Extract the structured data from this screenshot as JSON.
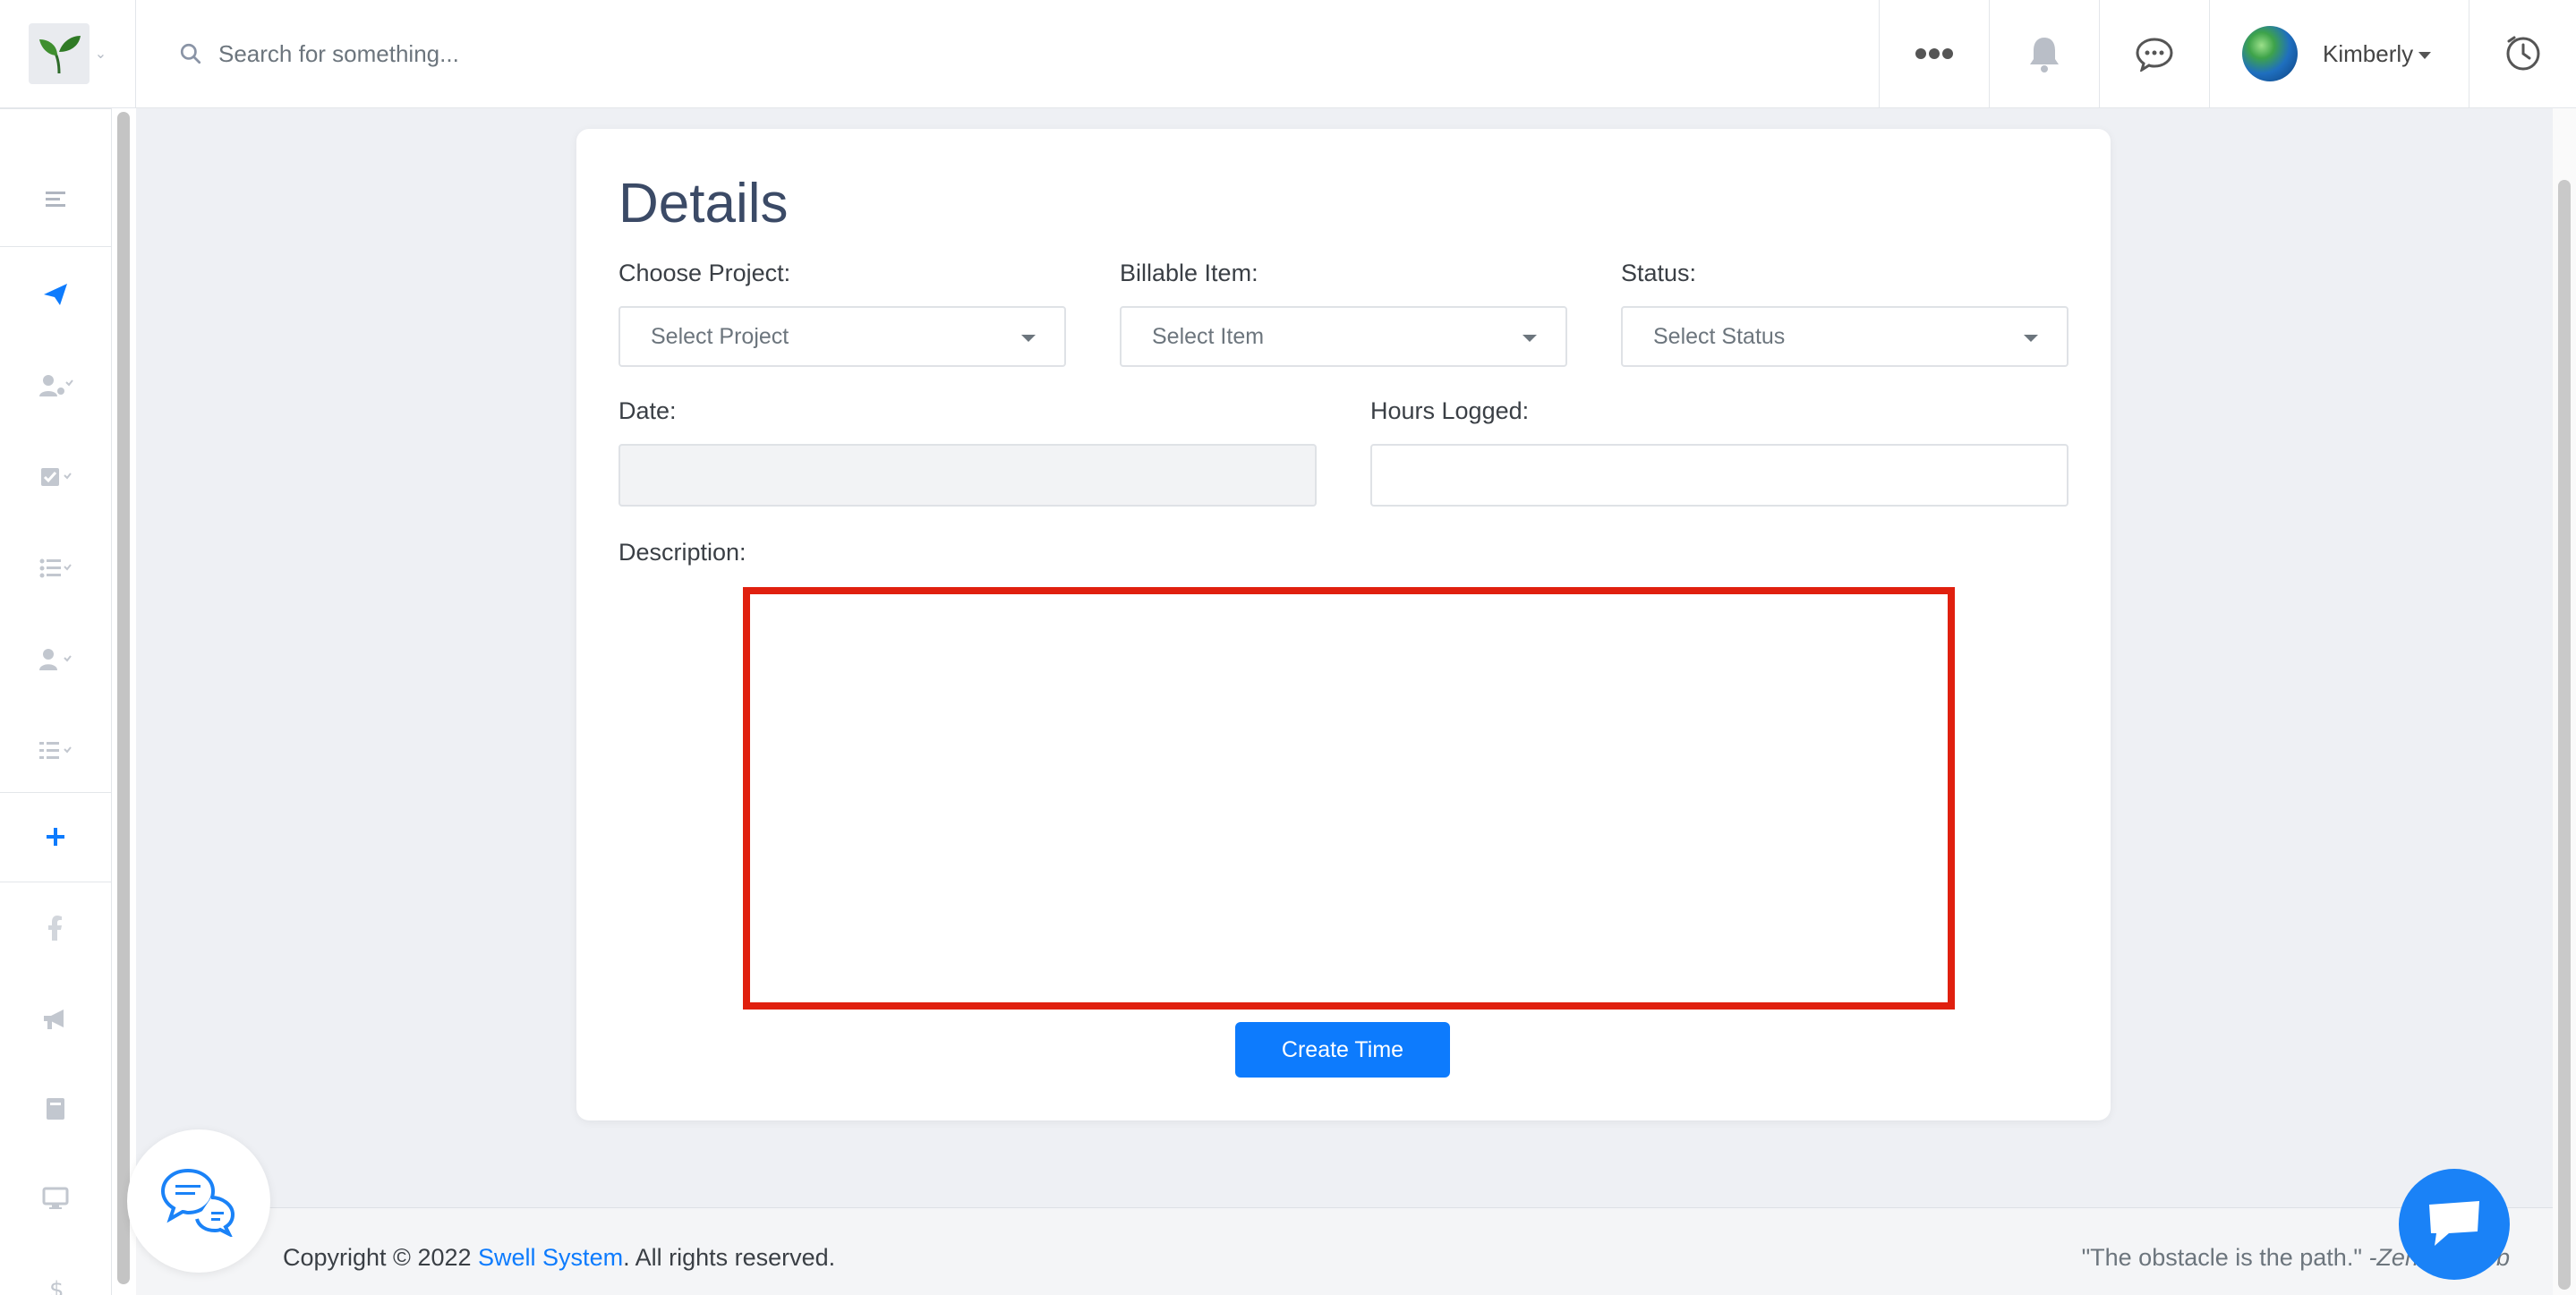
{
  "topbar": {
    "search_placeholder": "Search for something...",
    "user_name": "Kimberly"
  },
  "card": {
    "title": "Details",
    "choose_project_label": "Choose Project:",
    "project_select": "Select Project",
    "billable_item_label": "Billable Item:",
    "item_select": "Select Item",
    "status_label": "Status:",
    "status_select": "Select Status",
    "date_label": "Date:",
    "date_value": "",
    "hours_logged_label": "Hours Logged:",
    "hours_value": "",
    "description_label": "Description:",
    "create_button": "Create Time"
  },
  "footer": {
    "copyright_prefix": "Copyright © 2022",
    "company": "Swell System",
    "copyright_suffix": ". All rights reserved.",
    "quote_text": "\"The obstacle is the path.\"",
    "quote_author": "-Zen Proverb"
  },
  "colors": {
    "accent": "#0d7bfd",
    "highlight_border": "#e0200f",
    "title": "#3b4a66"
  }
}
